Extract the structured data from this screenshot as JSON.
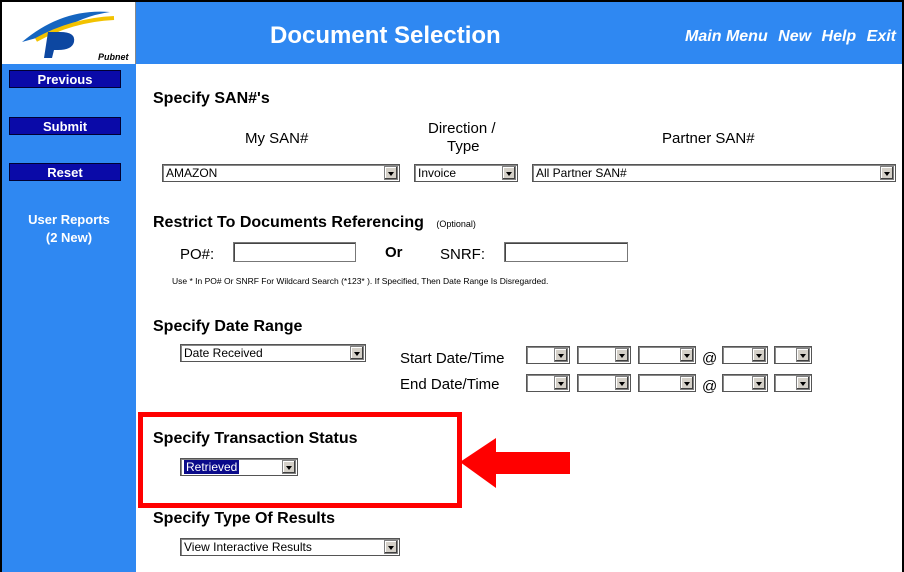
{
  "logo": {
    "text": "Pubnet"
  },
  "header": {
    "title": "Document Selection",
    "nav": [
      "Main Menu",
      "New",
      "Help",
      "Exit"
    ]
  },
  "sidebar": {
    "buttons": [
      "Previous",
      "Submit",
      "Reset"
    ],
    "reports_label": "User Reports",
    "reports_count": "(2 New)"
  },
  "san": {
    "heading": "Specify SAN#'s",
    "my_san_label": "My SAN#",
    "direction_label_1": "Direction /",
    "direction_label_2": "Type",
    "partner_label": "Partner SAN#",
    "my_san_value": "AMAZON",
    "direction_value": "Invoice",
    "partner_value": "All Partner SAN#"
  },
  "restrict": {
    "heading": "Restrict To Documents Referencing",
    "optional": "(Optional)",
    "po_label": "PO#:",
    "or_label": "Or",
    "snrf_label": "SNRF:",
    "po_value": "",
    "snrf_value": "",
    "note": "Use * In PO# Or SNRF For Wildcard Search (*123* ). If Specified, Then Date Range Is Disregarded."
  },
  "date_range": {
    "heading": "Specify Date Range",
    "type_value": "Date Received",
    "start_label": "Start Date/Time",
    "end_label": "End Date/Time",
    "at": "@"
  },
  "status": {
    "heading": "Specify Transaction Status",
    "value": "Retrieved"
  },
  "results": {
    "heading": "Specify Type Of Results",
    "value": "View Interactive Results"
  },
  "colors": {
    "brand_blue": "#2f88f2",
    "button_navy": "#0a0aa8",
    "callout_red": "#ff0000"
  }
}
